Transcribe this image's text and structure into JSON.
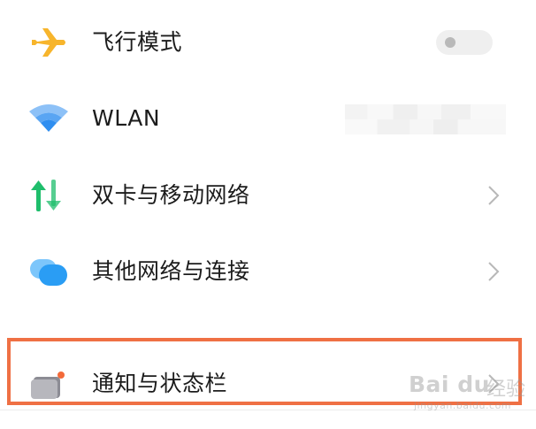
{
  "settings": {
    "items": [
      {
        "label": "飞行模式",
        "icon": "airplane-icon",
        "control": "toggle",
        "toggle_on": false
      },
      {
        "label": "WLAN",
        "icon": "wifi-icon",
        "control": "blurred-value"
      },
      {
        "label": "双卡与移动网络",
        "icon": "dual-sim-icon",
        "control": "chevron"
      },
      {
        "label": "其他网络与连接",
        "icon": "network-connections-icon",
        "control": "chevron"
      },
      {
        "label": "通知与状态栏",
        "icon": "notification-icon",
        "control": "chevron",
        "highlighted": true
      }
    ]
  },
  "watermark": {
    "logo": "Bai du",
    "text": "经验",
    "url": "jingyan.baidu.com"
  },
  "colors": {
    "airplane": "#f7b52c",
    "wifi": "#2f8ef0",
    "sim_green": "#1fbe6c",
    "bubbles": "#2a9df4",
    "highlight_border": "#ef7044",
    "notification_dot": "#f36a3a"
  }
}
